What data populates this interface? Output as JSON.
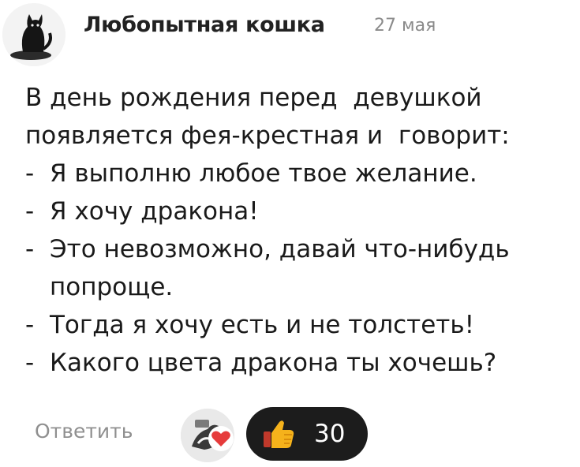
{
  "post": {
    "author": "Любопытная кошка",
    "date": "27 мая",
    "avatar_icon": "cat-avatar-icon"
  },
  "comment": {
    "lines": [
      "В день рождения перед  девушкой",
      "появляется фея-крестная и  говорит:"
    ],
    "dialogue": [
      {
        "dash": "-",
        "text": "Я выполню любое твое желание."
      },
      {
        "dash": "-",
        "text": "Я хочу дракона!"
      },
      {
        "dash": "-",
        "text": "Это невозможно, давай что-нибудь попроще."
      },
      {
        "dash": "-",
        "text": "Тогда я хочу есть и не толстеть!"
      },
      {
        "dash": "-",
        "text": "Какого цвета дракона ты хочешь?"
      }
    ]
  },
  "actions": {
    "reply_label": "Ответить",
    "like_count": "30",
    "like_icon": "thumbs-up-icon",
    "heart_icon": "heart-icon",
    "accent_red": "#e63b3b",
    "like_pill_color": "#1c1c1c"
  }
}
